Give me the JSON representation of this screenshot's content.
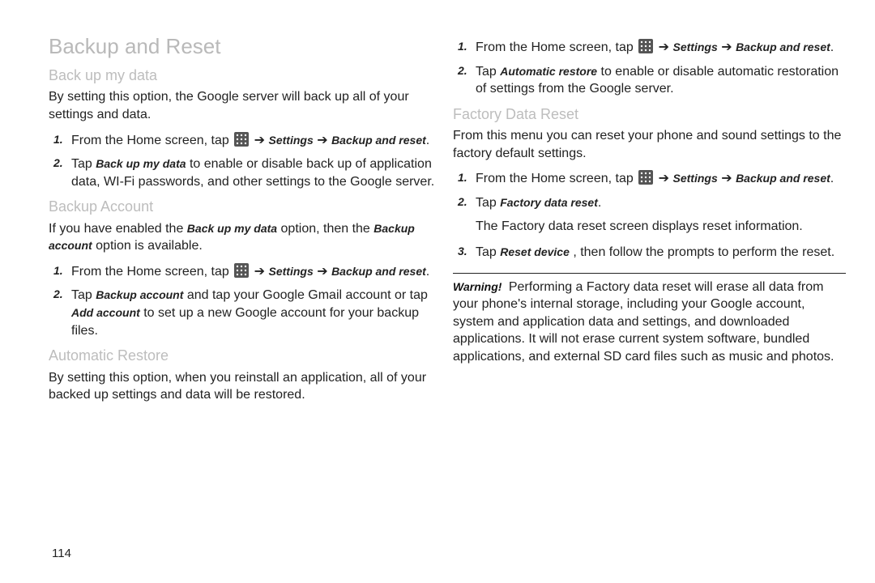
{
  "heading": "Backup and Reset",
  "sections": {
    "backup_my_data": {
      "title": "Back up my data",
      "intro": "By setting this option, the Google server will back up all of your settings and data.",
      "step1a": "From the Home screen, tap",
      "step1b": "➔",
      "step1c": "➔",
      "step2a": "Tap",
      "step2b": " to enable or disable back up of application data, WI-Fi passwords, and other settings to the Google server."
    },
    "backup_account": {
      "title": "Backup Account",
      "intro_a": "If you have enabled the ",
      "intro_b": " option, then the ",
      "intro_c": " option is available.",
      "step2a": "Tap",
      "step2b": " and tap your Google Gmail account or tap",
      "step2c": " to set up a new Google account for your backup files."
    },
    "automatic_restore": {
      "title": "Automatic Restore",
      "intro": "By setting this option, when you reinstall an application, all of your backed up settings and data will be restored.",
      "step2a": "Tap",
      "step2b": " to enable or disable automatic restoration of settings from the Google server."
    },
    "factory_reset": {
      "title": "Factory Data Reset",
      "intro": "From this menu you can reset your phone and sound settings to the factory default settings.",
      "step2a": "Tap",
      "step_post": "The Factory data reset screen displays reset information.",
      "step3a": "Tap",
      "step3b": ", then follow the prompts to perform the reset."
    }
  },
  "ui_terms": {
    "settings": "Settings",
    "backup_and_reset": "Backup and reset",
    "back_up_my_data": "Back up my data",
    "backup_account": "Backup account",
    "add_account": "Add account",
    "automatic_restore": "Automatic restore",
    "factory_data_reset": "Factory data reset",
    "reset_device": "Reset device"
  },
  "warning": {
    "label": "Warning!",
    "body": "Performing a Factory data reset will erase all data from your phone's internal storage, including your Google account, system and application data and settings, and downloaded applications. It will not erase current system software, bundled applications, and external SD card files such as music and photos."
  },
  "page_number": "114",
  "colors": {
    "faded": "#bbbbbb"
  },
  "icons": {
    "apps_grid": "apps-grid-icon"
  }
}
